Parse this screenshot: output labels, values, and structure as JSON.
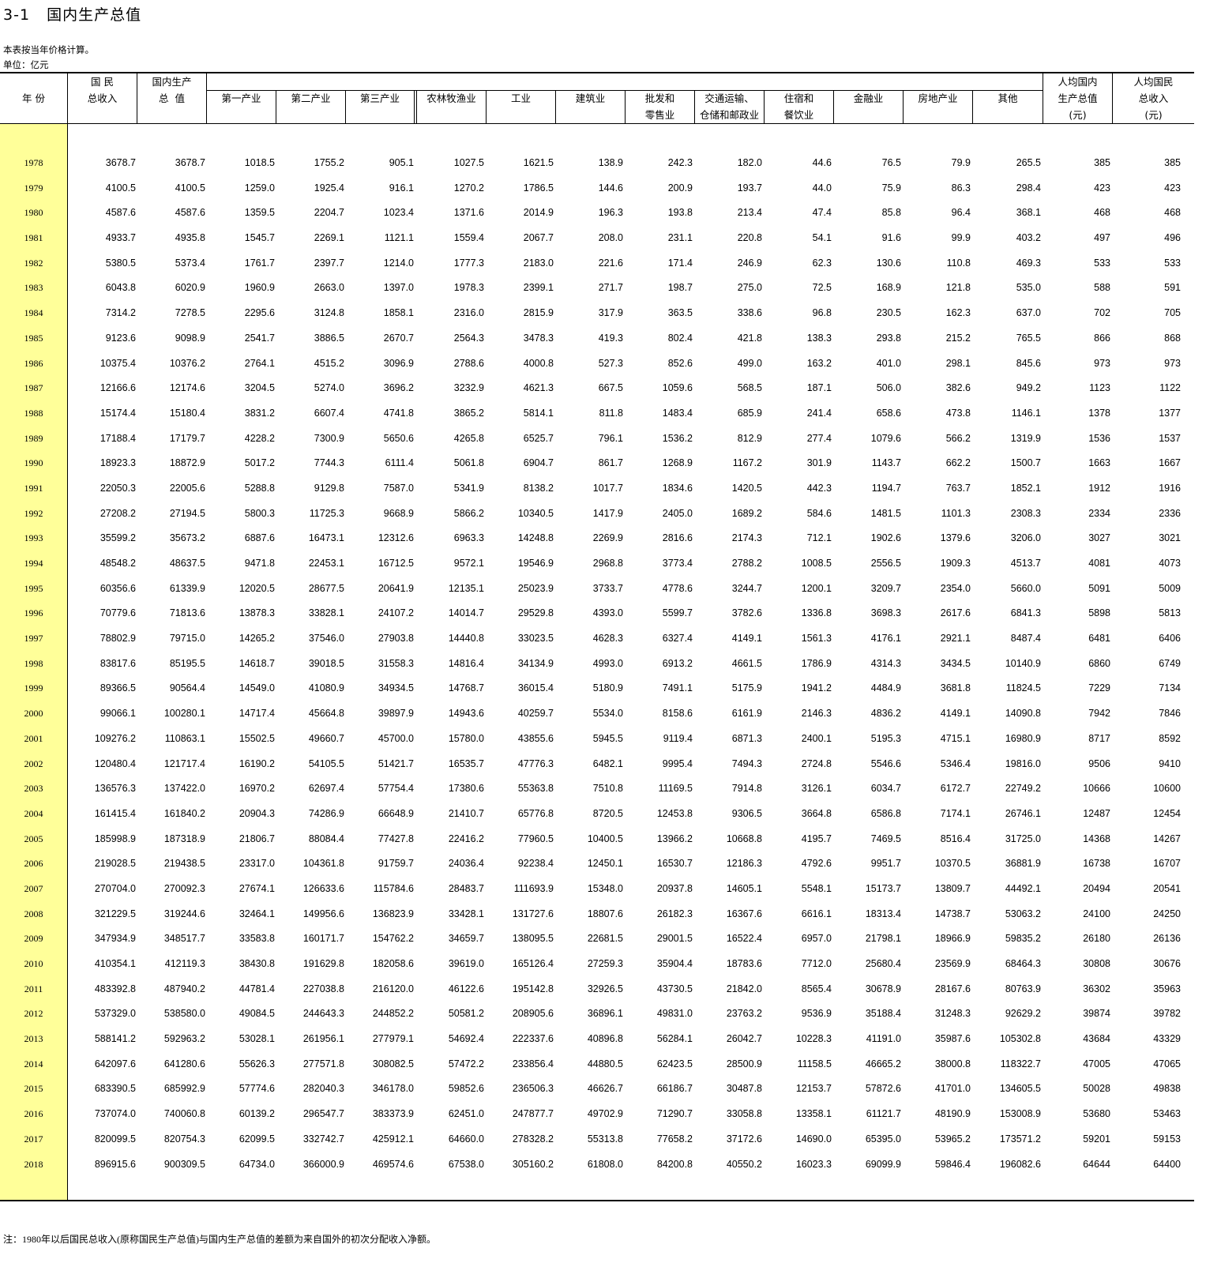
{
  "title": "3-1   国内生产总值",
  "notes": {
    "price_basis": "本表按当年价格计算。",
    "unit": "单位：亿元"
  },
  "footnote": "注：1980年以后国民总收入(原称国民生产总值)与国内生产总值的差额为来自国外的初次分配收入净额。",
  "header": {
    "year": "年 份",
    "gni": [
      "国 民",
      "总收入"
    ],
    "gdp": [
      "国内生产",
      "总  值"
    ],
    "primary": "第一产业",
    "secondary": "第二产业",
    "tertiary": "第三产业",
    "agri": "农林牧渔业",
    "industry": "工业",
    "construction": "建筑业",
    "trade": [
      "批发和",
      "零售业"
    ],
    "transport": [
      "交通运输、",
      "仓储和邮政业"
    ],
    "hotel": [
      "住宿和",
      "餐饮业"
    ],
    "finance": "金融业",
    "realestate": "房地产业",
    "other": "其他",
    "gdp_pc": [
      "人均国内",
      "生产总值",
      "(元)"
    ],
    "gni_pc": [
      "人均国民",
      "总收入",
      "(元)"
    ]
  },
  "accent_colors": {
    "year_column_bg": "#ffff99"
  },
  "rows": [
    [
      "1978",
      "3678.7",
      "3678.7",
      "1018.5",
      "1755.2",
      "905.1",
      "1027.5",
      "1621.5",
      "138.9",
      "242.3",
      "182.0",
      "44.6",
      "76.5",
      "79.9",
      "265.5",
      "385",
      "385"
    ],
    [
      "1979",
      "4100.5",
      "4100.5",
      "1259.0",
      "1925.4",
      "916.1",
      "1270.2",
      "1786.5",
      "144.6",
      "200.9",
      "193.7",
      "44.0",
      "75.9",
      "86.3",
      "298.4",
      "423",
      "423"
    ],
    [
      "1980",
      "4587.6",
      "4587.6",
      "1359.5",
      "2204.7",
      "1023.4",
      "1371.6",
      "2014.9",
      "196.3",
      "193.8",
      "213.4",
      "47.4",
      "85.8",
      "96.4",
      "368.1",
      "468",
      "468"
    ],
    [
      "1981",
      "4933.7",
      "4935.8",
      "1545.7",
      "2269.1",
      "1121.1",
      "1559.4",
      "2067.7",
      "208.0",
      "231.1",
      "220.8",
      "54.1",
      "91.6",
      "99.9",
      "403.2",
      "497",
      "496"
    ],
    [
      "1982",
      "5380.5",
      "5373.4",
      "1761.7",
      "2397.7",
      "1214.0",
      "1777.3",
      "2183.0",
      "221.6",
      "171.4",
      "246.9",
      "62.3",
      "130.6",
      "110.8",
      "469.3",
      "533",
      "533"
    ],
    [
      "1983",
      "6043.8",
      "6020.9",
      "1960.9",
      "2663.0",
      "1397.0",
      "1978.3",
      "2399.1",
      "271.7",
      "198.7",
      "275.0",
      "72.5",
      "168.9",
      "121.8",
      "535.0",
      "588",
      "591"
    ],
    [
      "1984",
      "7314.2",
      "7278.5",
      "2295.6",
      "3124.8",
      "1858.1",
      "2316.0",
      "2815.9",
      "317.9",
      "363.5",
      "338.6",
      "96.8",
      "230.5",
      "162.3",
      "637.0",
      "702",
      "705"
    ],
    [
      "1985",
      "9123.6",
      "9098.9",
      "2541.7",
      "3886.5",
      "2670.7",
      "2564.3",
      "3478.3",
      "419.3",
      "802.4",
      "421.8",
      "138.3",
      "293.8",
      "215.2",
      "765.5",
      "866",
      "868"
    ],
    [
      "1986",
      "10375.4",
      "10376.2",
      "2764.1",
      "4515.2",
      "3096.9",
      "2788.6",
      "4000.8",
      "527.3",
      "852.6",
      "499.0",
      "163.2",
      "401.0",
      "298.1",
      "845.6",
      "973",
      "973"
    ],
    [
      "1987",
      "12166.6",
      "12174.6",
      "3204.5",
      "5274.0",
      "3696.2",
      "3232.9",
      "4621.3",
      "667.5",
      "1059.6",
      "568.5",
      "187.1",
      "506.0",
      "382.6",
      "949.2",
      "1123",
      "1122"
    ],
    [
      "1988",
      "15174.4",
      "15180.4",
      "3831.2",
      "6607.4",
      "4741.8",
      "3865.2",
      "5814.1",
      "811.8",
      "1483.4",
      "685.9",
      "241.4",
      "658.6",
      "473.8",
      "1146.1",
      "1378",
      "1377"
    ],
    [
      "1989",
      "17188.4",
      "17179.7",
      "4228.2",
      "7300.9",
      "5650.6",
      "4265.8",
      "6525.7",
      "796.1",
      "1536.2",
      "812.9",
      "277.4",
      "1079.6",
      "566.2",
      "1319.9",
      "1536",
      "1537"
    ],
    [
      "1990",
      "18923.3",
      "18872.9",
      "5017.2",
      "7744.3",
      "6111.4",
      "5061.8",
      "6904.7",
      "861.7",
      "1268.9",
      "1167.2",
      "301.9",
      "1143.7",
      "662.2",
      "1500.7",
      "1663",
      "1667"
    ],
    [
      "1991",
      "22050.3",
      "22005.6",
      "5288.8",
      "9129.8",
      "7587.0",
      "5341.9",
      "8138.2",
      "1017.7",
      "1834.6",
      "1420.5",
      "442.3",
      "1194.7",
      "763.7",
      "1852.1",
      "1912",
      "1916"
    ],
    [
      "1992",
      "27208.2",
      "27194.5",
      "5800.3",
      "11725.3",
      "9668.9",
      "5866.2",
      "10340.5",
      "1417.9",
      "2405.0",
      "1689.2",
      "584.6",
      "1481.5",
      "1101.3",
      "2308.3",
      "2334",
      "2336"
    ],
    [
      "1993",
      "35599.2",
      "35673.2",
      "6887.6",
      "16473.1",
      "12312.6",
      "6963.3",
      "14248.8",
      "2269.9",
      "2816.6",
      "2174.3",
      "712.1",
      "1902.6",
      "1379.6",
      "3206.0",
      "3027",
      "3021"
    ],
    [
      "1994",
      "48548.2",
      "48637.5",
      "9471.8",
      "22453.1",
      "16712.5",
      "9572.1",
      "19546.9",
      "2968.8",
      "3773.4",
      "2788.2",
      "1008.5",
      "2556.5",
      "1909.3",
      "4513.7",
      "4081",
      "4073"
    ],
    [
      "1995",
      "60356.6",
      "61339.9",
      "12020.5",
      "28677.5",
      "20641.9",
      "12135.1",
      "25023.9",
      "3733.7",
      "4778.6",
      "3244.7",
      "1200.1",
      "3209.7",
      "2354.0",
      "5660.0",
      "5091",
      "5009"
    ],
    [
      "1996",
      "70779.6",
      "71813.6",
      "13878.3",
      "33828.1",
      "24107.2",
      "14014.7",
      "29529.8",
      "4393.0",
      "5599.7",
      "3782.6",
      "1336.8",
      "3698.3",
      "2617.6",
      "6841.3",
      "5898",
      "5813"
    ],
    [
      "1997",
      "78802.9",
      "79715.0",
      "14265.2",
      "37546.0",
      "27903.8",
      "14440.8",
      "33023.5",
      "4628.3",
      "6327.4",
      "4149.1",
      "1561.3",
      "4176.1",
      "2921.1",
      "8487.4",
      "6481",
      "6406"
    ],
    [
      "1998",
      "83817.6",
      "85195.5",
      "14618.7",
      "39018.5",
      "31558.3",
      "14816.4",
      "34134.9",
      "4993.0",
      "6913.2",
      "4661.5",
      "1786.9",
      "4314.3",
      "3434.5",
      "10140.9",
      "6860",
      "6749"
    ],
    [
      "1999",
      "89366.5",
      "90564.4",
      "14549.0",
      "41080.9",
      "34934.5",
      "14768.7",
      "36015.4",
      "5180.9",
      "7491.1",
      "5175.9",
      "1941.2",
      "4484.9",
      "3681.8",
      "11824.5",
      "7229",
      "7134"
    ],
    [
      "2000",
      "99066.1",
      "100280.1",
      "14717.4",
      "45664.8",
      "39897.9",
      "14943.6",
      "40259.7",
      "5534.0",
      "8158.6",
      "6161.9",
      "2146.3",
      "4836.2",
      "4149.1",
      "14090.8",
      "7942",
      "7846"
    ],
    [
      "2001",
      "109276.2",
      "110863.1",
      "15502.5",
      "49660.7",
      "45700.0",
      "15780.0",
      "43855.6",
      "5945.5",
      "9119.4",
      "6871.3",
      "2400.1",
      "5195.3",
      "4715.1",
      "16980.9",
      "8717",
      "8592"
    ],
    [
      "2002",
      "120480.4",
      "121717.4",
      "16190.2",
      "54105.5",
      "51421.7",
      "16535.7",
      "47776.3",
      "6482.1",
      "9995.4",
      "7494.3",
      "2724.8",
      "5546.6",
      "5346.4",
      "19816.0",
      "9506",
      "9410"
    ],
    [
      "2003",
      "136576.3",
      "137422.0",
      "16970.2",
      "62697.4",
      "57754.4",
      "17380.6",
      "55363.8",
      "7510.8",
      "11169.5",
      "7914.8",
      "3126.1",
      "6034.7",
      "6172.7",
      "22749.2",
      "10666",
      "10600"
    ],
    [
      "2004",
      "161415.4",
      "161840.2",
      "20904.3",
      "74286.9",
      "66648.9",
      "21410.7",
      "65776.8",
      "8720.5",
      "12453.8",
      "9306.5",
      "3664.8",
      "6586.8",
      "7174.1",
      "26746.1",
      "12487",
      "12454"
    ],
    [
      "2005",
      "185998.9",
      "187318.9",
      "21806.7",
      "88084.4",
      "77427.8",
      "22416.2",
      "77960.5",
      "10400.5",
      "13966.2",
      "10668.8",
      "4195.7",
      "7469.5",
      "8516.4",
      "31725.0",
      "14368",
      "14267"
    ],
    [
      "2006",
      "219028.5",
      "219438.5",
      "23317.0",
      "104361.8",
      "91759.7",
      "24036.4",
      "92238.4",
      "12450.1",
      "16530.7",
      "12186.3",
      "4792.6",
      "9951.7",
      "10370.5",
      "36881.9",
      "16738",
      "16707"
    ],
    [
      "2007",
      "270704.0",
      "270092.3",
      "27674.1",
      "126633.6",
      "115784.6",
      "28483.7",
      "111693.9",
      "15348.0",
      "20937.8",
      "14605.1",
      "5548.1",
      "15173.7",
      "13809.7",
      "44492.1",
      "20494",
      "20541"
    ],
    [
      "2008",
      "321229.5",
      "319244.6",
      "32464.1",
      "149956.6",
      "136823.9",
      "33428.1",
      "131727.6",
      "18807.6",
      "26182.3",
      "16367.6",
      "6616.1",
      "18313.4",
      "14738.7",
      "53063.2",
      "24100",
      "24250"
    ],
    [
      "2009",
      "347934.9",
      "348517.7",
      "33583.8",
      "160171.7",
      "154762.2",
      "34659.7",
      "138095.5",
      "22681.5",
      "29001.5",
      "16522.4",
      "6957.0",
      "21798.1",
      "18966.9",
      "59835.2",
      "26180",
      "26136"
    ],
    [
      "2010",
      "410354.1",
      "412119.3",
      "38430.8",
      "191629.8",
      "182058.6",
      "39619.0",
      "165126.4",
      "27259.3",
      "35904.4",
      "18783.6",
      "7712.0",
      "25680.4",
      "23569.9",
      "68464.3",
      "30808",
      "30676"
    ],
    [
      "2011",
      "483392.8",
      "487940.2",
      "44781.4",
      "227038.8",
      "216120.0",
      "46122.6",
      "195142.8",
      "32926.5",
      "43730.5",
      "21842.0",
      "8565.4",
      "30678.9",
      "28167.6",
      "80763.9",
      "36302",
      "35963"
    ],
    [
      "2012",
      "537329.0",
      "538580.0",
      "49084.5",
      "244643.3",
      "244852.2",
      "50581.2",
      "208905.6",
      "36896.1",
      "49831.0",
      "23763.2",
      "9536.9",
      "35188.4",
      "31248.3",
      "92629.2",
      "39874",
      "39782"
    ],
    [
      "2013",
      "588141.2",
      "592963.2",
      "53028.1",
      "261956.1",
      "277979.1",
      "54692.4",
      "222337.6",
      "40896.8",
      "56284.1",
      "26042.7",
      "10228.3",
      "41191.0",
      "35987.6",
      "105302.8",
      "43684",
      "43329"
    ],
    [
      "2014",
      "642097.6",
      "641280.6",
      "55626.3",
      "277571.8",
      "308082.5",
      "57472.2",
      "233856.4",
      "44880.5",
      "62423.5",
      "28500.9",
      "11158.5",
      "46665.2",
      "38000.8",
      "118322.7",
      "47005",
      "47065"
    ],
    [
      "2015",
      "683390.5",
      "685992.9",
      "57774.6",
      "282040.3",
      "346178.0",
      "59852.6",
      "236506.3",
      "46626.7",
      "66186.7",
      "30487.8",
      "12153.7",
      "57872.6",
      "41701.0",
      "134605.5",
      "50028",
      "49838"
    ],
    [
      "2016",
      "737074.0",
      "740060.8",
      "60139.2",
      "296547.7",
      "383373.9",
      "62451.0",
      "247877.7",
      "49702.9",
      "71290.7",
      "33058.8",
      "13358.1",
      "61121.7",
      "48190.9",
      "153008.9",
      "53680",
      "53463"
    ],
    [
      "2017",
      "820099.5",
      "820754.3",
      "62099.5",
      "332742.7",
      "425912.1",
      "64660.0",
      "278328.2",
      "55313.8",
      "77658.2",
      "37172.6",
      "14690.0",
      "65395.0",
      "53965.2",
      "173571.2",
      "59201",
      "59153"
    ],
    [
      "2018",
      "896915.6",
      "900309.5",
      "64734.0",
      "366000.9",
      "469574.6",
      "67538.0",
      "305160.2",
      "61808.0",
      "84200.8",
      "40550.2",
      "16023.3",
      "69099.9",
      "59846.4",
      "196082.6",
      "64644",
      "64400"
    ]
  ]
}
